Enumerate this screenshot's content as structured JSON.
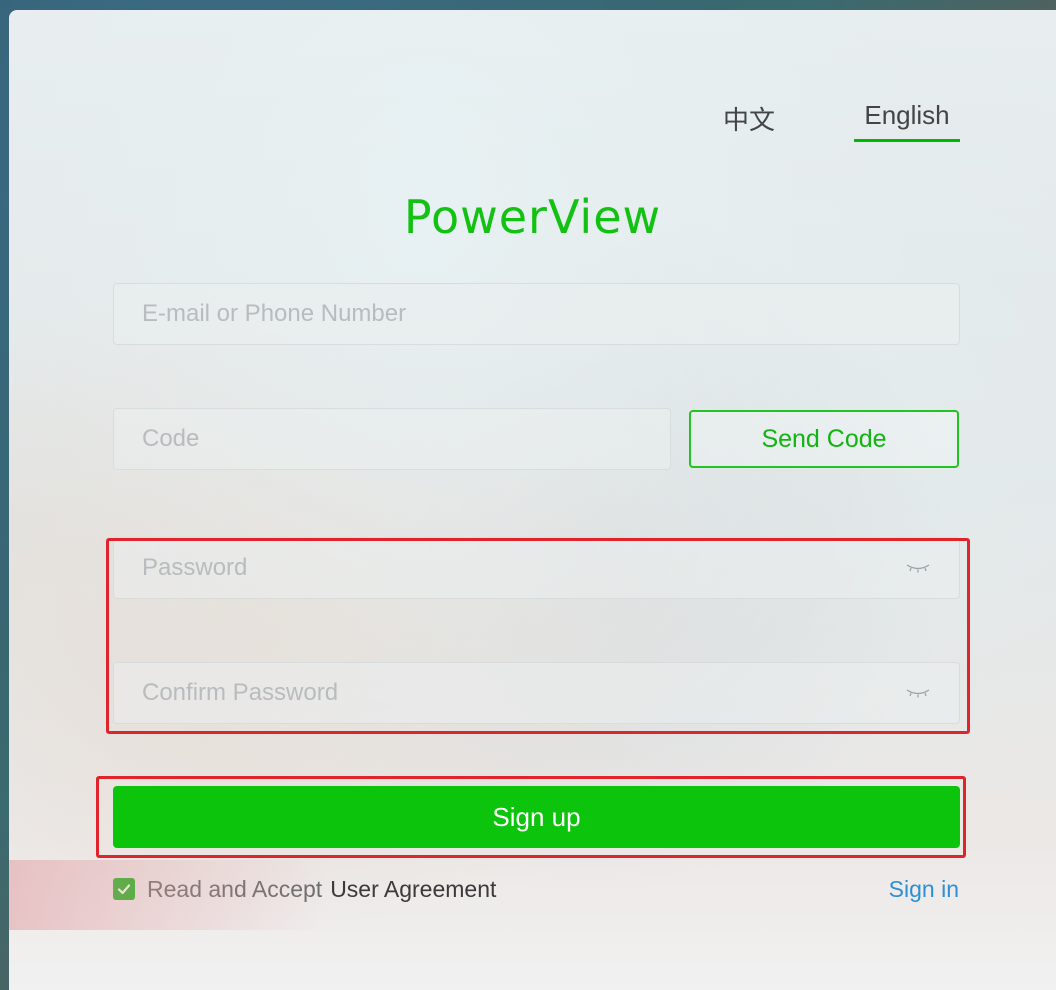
{
  "language": {
    "chinese_label": "中文",
    "english_label": "English",
    "selected": "English"
  },
  "logo": {
    "text": "PowerView"
  },
  "form": {
    "email_placeholder": "E-mail or Phone Number",
    "code_placeholder": "Code",
    "send_code_label": "Send Code",
    "password_placeholder": "Password",
    "confirm_password_placeholder": "Confirm Password",
    "signup_label": "Sign up"
  },
  "agreement": {
    "prefix": "Read and Accept",
    "link_label": "User Agreement",
    "checked": true
  },
  "signin_label": "Sign in",
  "colors": {
    "brand": "#12c112",
    "primary_button": "#0cc40c",
    "link": "#2d8fd6",
    "highlight": "#e0242c"
  },
  "icons": {
    "password_toggle": "eye-closed-icon",
    "confirm_toggle": "eye-closed-icon",
    "checkbox": "checkmark-icon"
  }
}
